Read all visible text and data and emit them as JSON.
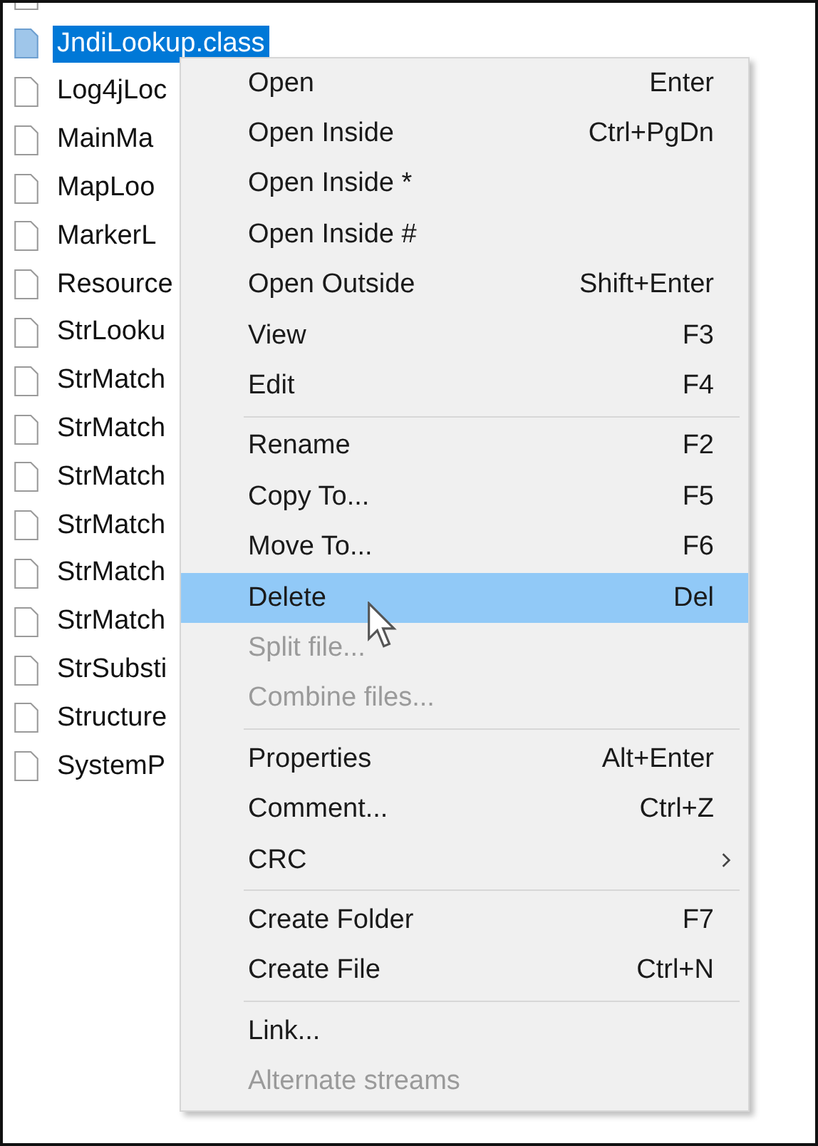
{
  "files": [
    {
      "name": "JndiLookup.class",
      "selected": true
    },
    {
      "name": "Log4jLoc",
      "selected": false
    },
    {
      "name": "MainMa",
      "selected": false
    },
    {
      "name": "MapLoo",
      "selected": false
    },
    {
      "name": "MarkerL",
      "selected": false
    },
    {
      "name": "Resource",
      "selected": false
    },
    {
      "name": "StrLooku",
      "selected": false
    },
    {
      "name": "StrMatch",
      "selected": false
    },
    {
      "name": "StrMatch",
      "selected": false
    },
    {
      "name": "StrMatch",
      "selected": false
    },
    {
      "name": "StrMatch",
      "selected": false
    },
    {
      "name": "StrMatch",
      "selected": false
    },
    {
      "name": "StrMatch",
      "selected": false
    },
    {
      "name": "StrSubsti",
      "selected": false
    },
    {
      "name": "Structure",
      "selected": false
    },
    {
      "name": "SystemP",
      "selected": false
    }
  ],
  "context_menu": {
    "items": [
      {
        "kind": "item",
        "label": "Open",
        "shortcut": "Enter",
        "selected": false,
        "disabled": false
      },
      {
        "kind": "item",
        "label": "Open Inside",
        "shortcut": "Ctrl+PgDn",
        "selected": false,
        "disabled": false
      },
      {
        "kind": "item",
        "label": "Open Inside *",
        "selected": false,
        "disabled": false
      },
      {
        "kind": "item",
        "label": "Open Inside #",
        "selected": false,
        "disabled": false
      },
      {
        "kind": "item",
        "label": "Open Outside",
        "shortcut": "Shift+Enter",
        "selected": false,
        "disabled": false
      },
      {
        "kind": "item",
        "label": "View",
        "shortcut": "F3",
        "selected": false,
        "disabled": false
      },
      {
        "kind": "item",
        "label": "Edit",
        "shortcut": "F4",
        "selected": false,
        "disabled": false
      },
      {
        "kind": "separator"
      },
      {
        "kind": "item",
        "label": "Rename",
        "shortcut": "F2",
        "selected": false,
        "disabled": false
      },
      {
        "kind": "item",
        "label": "Copy To...",
        "shortcut": "F5",
        "selected": false,
        "disabled": false
      },
      {
        "kind": "item",
        "label": "Move To...",
        "shortcut": "F6",
        "selected": false,
        "disabled": false
      },
      {
        "kind": "item",
        "label": "Delete",
        "shortcut": "Del",
        "selected": true,
        "disabled": false
      },
      {
        "kind": "item",
        "label": "Split file...",
        "selected": false,
        "disabled": true
      },
      {
        "kind": "item",
        "label": "Combine files...",
        "selected": false,
        "disabled": true
      },
      {
        "kind": "separator"
      },
      {
        "kind": "item",
        "label": "Properties",
        "shortcut": "Alt+Enter",
        "selected": false,
        "disabled": false
      },
      {
        "kind": "item",
        "label": "Comment...",
        "shortcut": "Ctrl+Z",
        "selected": false,
        "disabled": false
      },
      {
        "kind": "submenu",
        "label": "CRC",
        "selected": false,
        "disabled": false
      },
      {
        "kind": "separator"
      },
      {
        "kind": "item",
        "label": "Create Folder",
        "shortcut": "F7",
        "selected": false,
        "disabled": false
      },
      {
        "kind": "item",
        "label": "Create File",
        "shortcut": "Ctrl+N",
        "selected": false,
        "disabled": false
      },
      {
        "kind": "separator"
      },
      {
        "kind": "item",
        "label": "Link...",
        "selected": false,
        "disabled": false
      },
      {
        "kind": "item",
        "label": "Alternate streams",
        "selected": false,
        "disabled": true
      }
    ]
  }
}
